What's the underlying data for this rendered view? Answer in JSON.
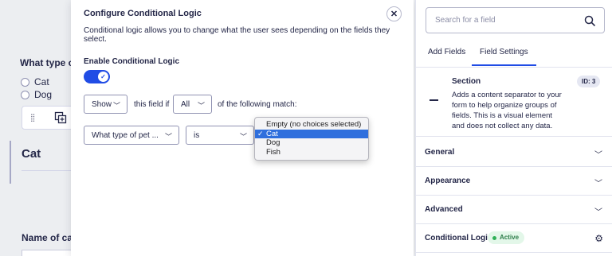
{
  "canvas": {
    "question_label": "What type of",
    "choices": [
      "Cat",
      "Dog"
    ],
    "section_title": "Cat",
    "name_label": "Name of cat"
  },
  "modal": {
    "title": "Configure Conditional Logic",
    "description": "Conditional logic allows you to change what the user sees depending on the fields they select.",
    "enable_label": "Enable Conditional Logic",
    "toggle_on": true,
    "action_select": "Show",
    "text_field_if": "this field if",
    "match_select": "All",
    "text_following": "of the following match:",
    "field_select": "What type of pet ...",
    "operator_select": "is",
    "value_dropdown": {
      "options": [
        "Empty (no choices selected)",
        "Cat",
        "Dog",
        "Fish"
      ],
      "selected": "Cat"
    }
  },
  "sidebar": {
    "search_placeholder": "Search for a field",
    "tabs": [
      "Add Fields",
      "Field Settings"
    ],
    "active_tab": "Field Settings",
    "field": {
      "name": "Section",
      "id_badge": "ID: 3",
      "description": "Adds a content separator to your form to help organize groups of fields. This is a visual element and does not collect any data."
    },
    "accordions": [
      "General",
      "Appearance",
      "Advanced"
    ],
    "conditional_logic": {
      "label": "Conditional Logic",
      "status": "Active"
    }
  },
  "colors": {
    "accent": "#204ce5",
    "active_badge_bg": "#e3f7e9",
    "active_badge_text": "#2e7d4a",
    "dropdown_highlight": "#2f6fdd"
  }
}
